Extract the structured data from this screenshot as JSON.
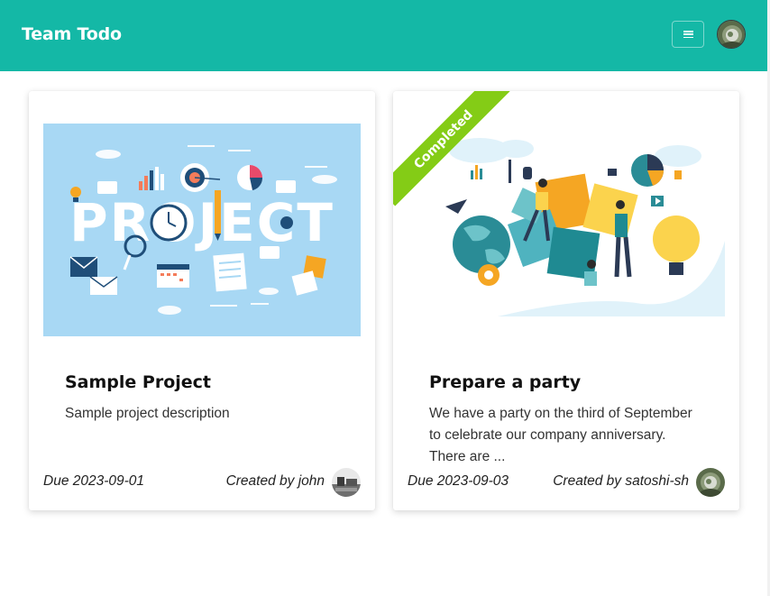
{
  "header": {
    "brand": "Team Todo",
    "menu_icon": "hamburger-menu-icon",
    "bg_color": "#14b8a6"
  },
  "cards": [
    {
      "title": "Sample Project",
      "description": "Sample project description",
      "due": "Due 2023-09-01",
      "created_by": "Created by john",
      "completed": false,
      "image_word": "PROJECT"
    },
    {
      "title": "Prepare a party",
      "description": "We have a party on the third of September to celebrate our company anniversary. There are ...",
      "due": "Due 2023-09-03",
      "created_by": "Created by satoshi-sh",
      "completed": true,
      "ribbon": "Completed",
      "ribbon_color": "#84cc16"
    }
  ]
}
